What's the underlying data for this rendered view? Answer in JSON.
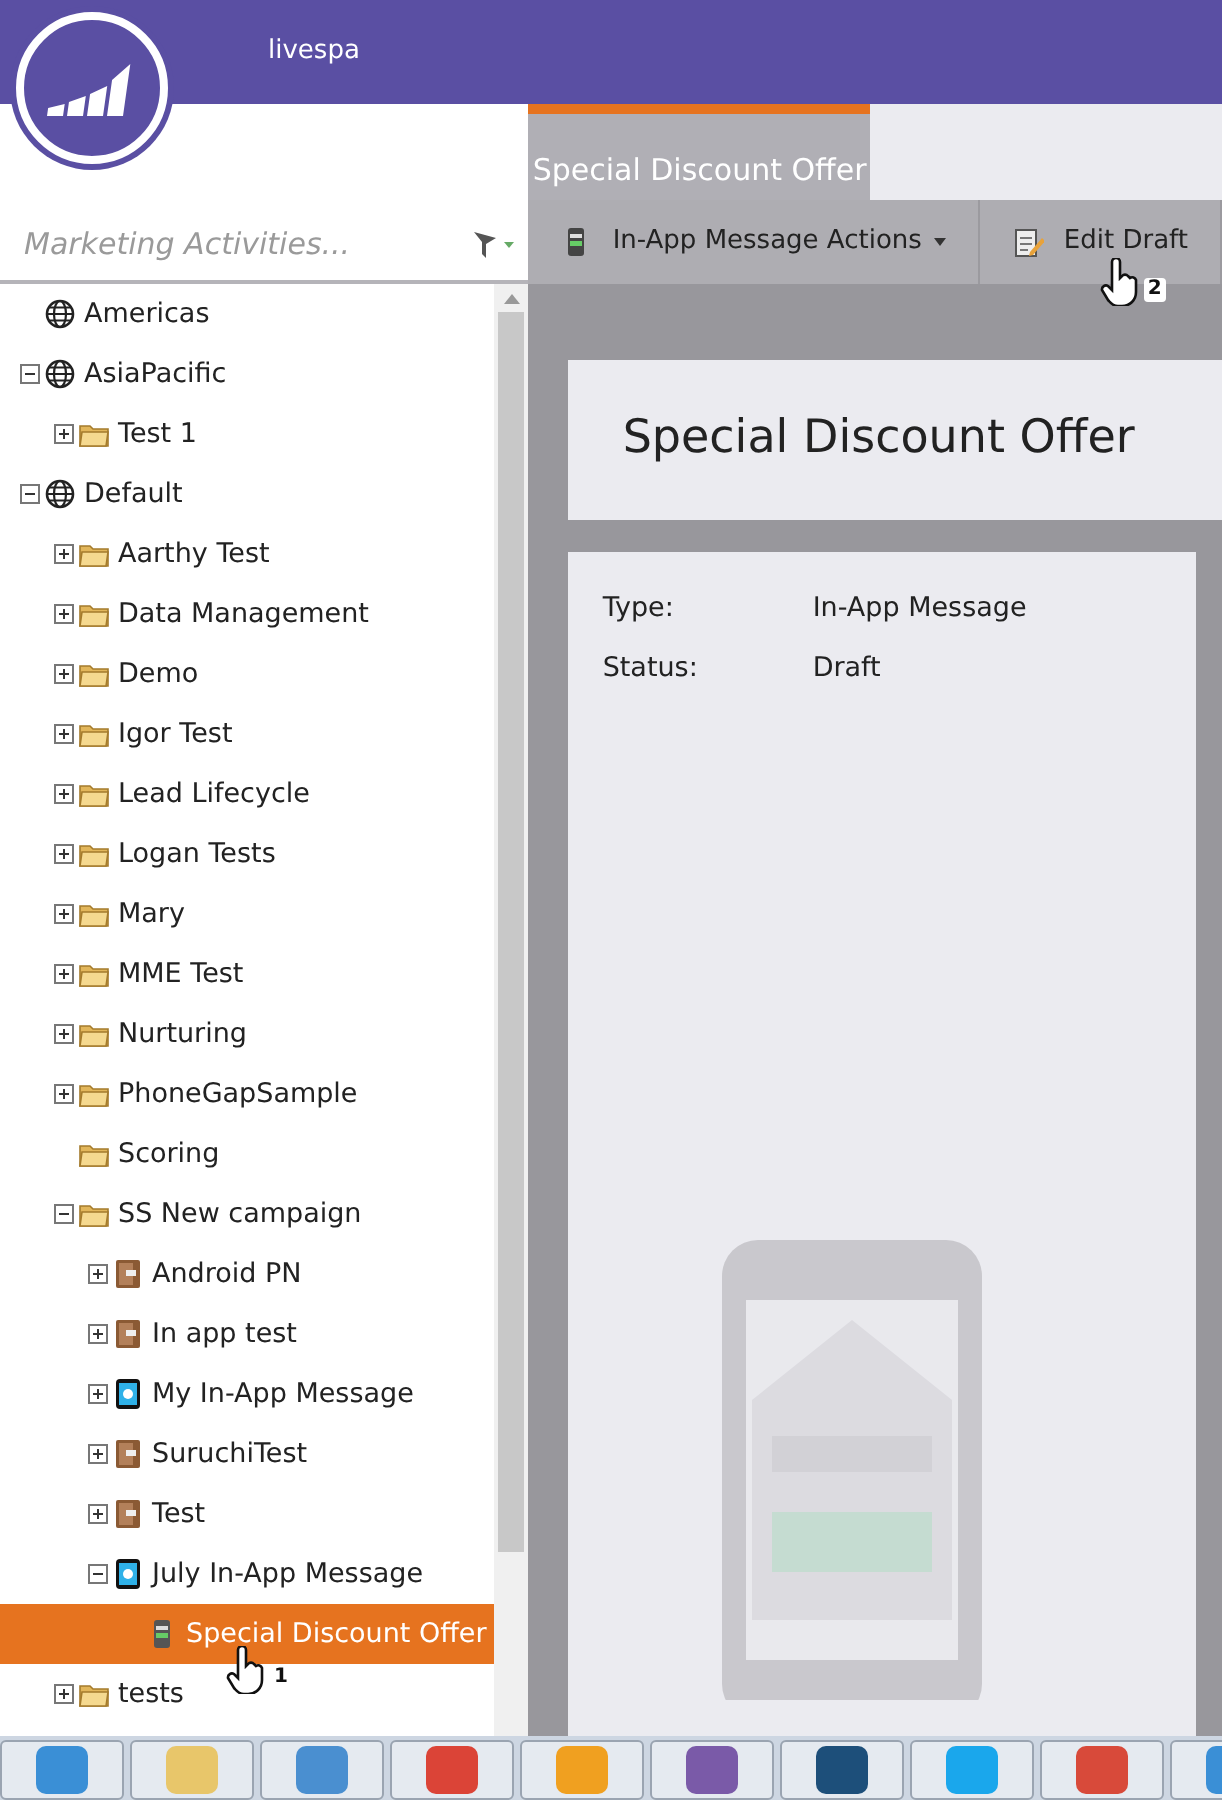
{
  "header": {
    "workspace": "livespa"
  },
  "search": {
    "placeholder": "Marketing Activities..."
  },
  "tree": [
    {
      "label": "Americas",
      "kind": "globe",
      "selected": false
    },
    {
      "label": "AsiaPacific",
      "kind": "globe",
      "expanded": true,
      "selected": false,
      "children": [
        {
          "label": "Test 1",
          "kind": "folder",
          "expanded": false,
          "selected": false
        }
      ]
    },
    {
      "label": "Default",
      "kind": "globe",
      "expanded": true,
      "selected": false,
      "children": [
        {
          "label": "Aarthy Test",
          "kind": "folder",
          "expanded": false,
          "selected": false
        },
        {
          "label": "Data Management",
          "kind": "folder",
          "expanded": false,
          "selected": false
        },
        {
          "label": "Demo",
          "kind": "folder",
          "expanded": false,
          "selected": false
        },
        {
          "label": "Igor Test",
          "kind": "folder",
          "expanded": false,
          "selected": false
        },
        {
          "label": "Lead Lifecycle",
          "kind": "folder",
          "expanded": false,
          "selected": false
        },
        {
          "label": "Logan Tests",
          "kind": "folder",
          "expanded": false,
          "selected": false
        },
        {
          "label": "Mary",
          "kind": "folder",
          "expanded": false,
          "selected": false
        },
        {
          "label": "MME Test",
          "kind": "folder",
          "expanded": false,
          "selected": false
        },
        {
          "label": "Nurturing",
          "kind": "folder",
          "expanded": false,
          "selected": false
        },
        {
          "label": "PhoneGapSample",
          "kind": "folder",
          "expanded": false,
          "selected": false
        },
        {
          "label": "Scoring",
          "kind": "folder",
          "selected": false
        },
        {
          "label": "SS New campaign",
          "kind": "folder",
          "expanded": true,
          "selected": false,
          "children": [
            {
              "label": "Android PN",
              "kind": "program",
              "expanded": false,
              "selected": false
            },
            {
              "label": "In app test",
              "kind": "program",
              "expanded": false,
              "selected": false
            },
            {
              "label": "My In-App Message",
              "kind": "inapp",
              "expanded": false,
              "selected": false
            },
            {
              "label": "SuruchiTest",
              "kind": "program",
              "expanded": false,
              "selected": false
            },
            {
              "label": "Test",
              "kind": "program",
              "expanded": false,
              "selected": false
            },
            {
              "label": "July In-App Message",
              "kind": "inapp",
              "expanded": true,
              "selected": false,
              "children": [
                {
                  "label": "Special Discount Offer",
                  "kind": "message",
                  "selected": true,
                  "cursor": "1"
                }
              ]
            }
          ]
        },
        {
          "label": "tests",
          "kind": "folder",
          "expanded": false,
          "selected": false
        }
      ]
    }
  ],
  "tabs": [
    {
      "label": "Special Discount Offer",
      "selected": true
    }
  ],
  "toolbar": [
    {
      "label": "In-App Message Actions",
      "kind": "menu"
    },
    {
      "label": "Edit Draft",
      "kind": "edit",
      "cursor": "2"
    }
  ],
  "asset": {
    "title": "Special Discount Offer",
    "fields": [
      {
        "label": "Type:",
        "value": "In-App Message"
      },
      {
        "label": "Status:",
        "value": "Draft"
      }
    ]
  },
  "taskbar": [
    {
      "kind": "browser"
    },
    {
      "kind": "folder"
    },
    {
      "kind": "media"
    },
    {
      "kind": "chrome"
    },
    {
      "kind": "mail"
    },
    {
      "kind": "chat"
    },
    {
      "kind": "snagit"
    },
    {
      "kind": "skype"
    },
    {
      "kind": "slack"
    },
    {
      "kind": "browser"
    }
  ]
}
